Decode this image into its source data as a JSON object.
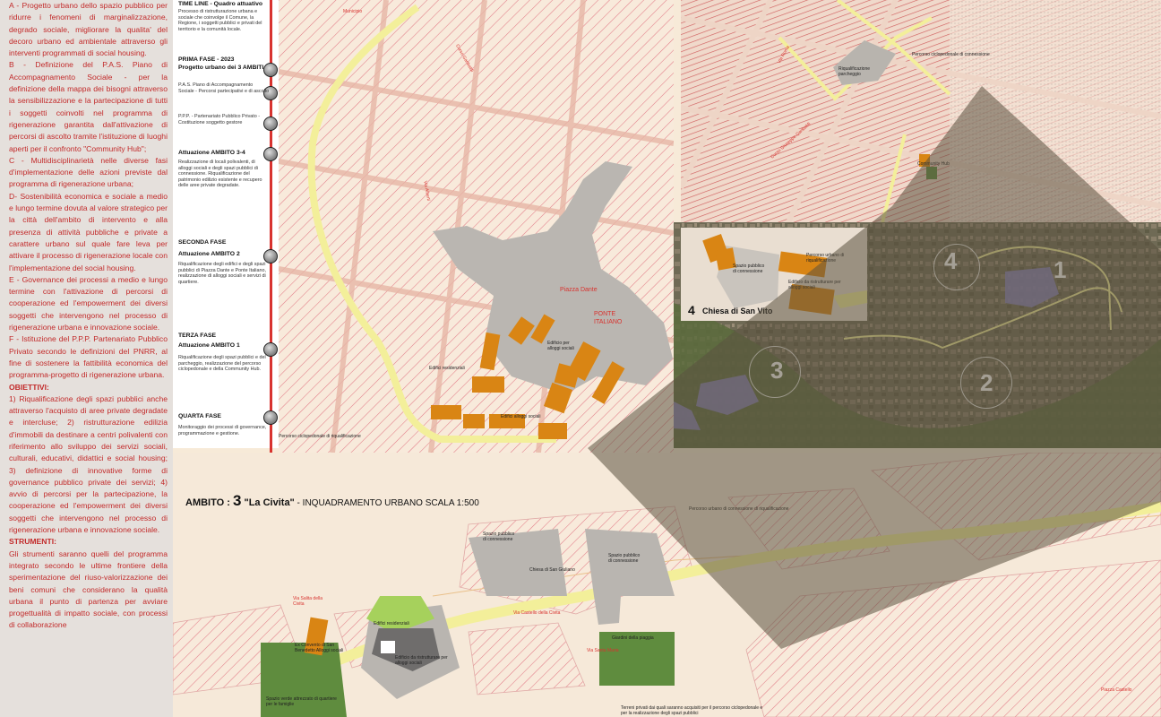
{
  "left_text": [
    {
      "text": "A - Progetto urbano dello spazio pubblico per ridurre i fenomeni di marginalizzazione, degrado sociale, migliorare la qualita' del decoro urbano ed ambientale attraverso gli interventi programmati di social housing.",
      "bold": false
    },
    {
      "text": "B - Definizione del P.A.S. Piano di Accompagnamento Sociale - per la definizione della mappa dei bisogni attraverso la sensibilizzazione e la partecipazione di tutti i soggetti coinvolti nel programma di rigenerazione garantita dall'attivazione di percorsi di ascolto tramite l'istituzione di luoghi aperti per il confronto \"Community Hub\";",
      "bold": false
    },
    {
      "text": "C - Multidisciplinarietà nelle diverse fasi d'implementazione delle azioni previste dal programma di rigenerazione urbana;",
      "bold": false
    },
    {
      "text": "D- Sostenibilità economica e sociale a medio e lungo termine dovuta al valore strategico per la città dell'ambito di intervento e alla presenza di attività pubbliche e private a carattere urbano sul quale fare leva per attivare il processo di rigenerazione locale con l'implementazione del social housing.",
      "bold": false
    },
    {
      "text": "E - Governance dei processi a medio e lungo termine con l'attivazione di percorsi di cooperazione ed l'empowerment dei diversi soggetti che intervengono nel processo di rigenerazione urbana e innovazione sociale.",
      "bold": false
    },
    {
      "text": "F - Istituzione del P.P.P. Partenariato Pubblico Privato secondo le definizioni del PNRR, al fine di sostenere la fattibilità economica del programma-progetto di rigenerazione urbana.",
      "bold": false
    },
    {
      "text": "OBIETTIVI:",
      "bold": true
    },
    {
      "text": "1) Riqualificazione degli spazi pubblici anche attraverso l'acquisto di aree private degradate e intercluse; 2) ristrutturazione edilizia d'immobili da destinare a centri polivalenti con riferimento allo sviluppo dei servizi sociali, culturali, educativi, didattici e social housing; 3) definizione di innovative forme di governance pubblico private dei servizi; 4) avvio di percorsi per la partecipazione, la cooperazione ed l'empowerment dei diversi soggetti che intervengono nel processo di rigenerazione urbana e innovazione sociale.",
      "bold": false
    },
    {
      "text": "STRUMENTI:",
      "bold": true
    },
    {
      "text": "Gli strumenti saranno quelli del programma integrato secondo le ultime frontiere della sperimentazione del riuso-valorizzazione dei beni comuni che considerano la qualità urbana il punto di partenza per avviare progettualità di impatto sociale, con processi di collaborazione",
      "bold": false
    }
  ],
  "timeline": {
    "time_line_label": "TIME LINE - Quadro attuativo",
    "intro": "Processo di ristrutturazione urbana e sociale che coinvolge il Comune, la Regione, i soggetti pubblici e privati del territorio e la comunità locale.",
    "phases": [
      {
        "title": "PRIMA FASE - 2023",
        "subtitle": "Progetto urbano dei 3 AMBITI",
        "body": ""
      },
      {
        "title": "",
        "subtitle": "",
        "body": "P.A.S. Piano di Accompagnamento Sociale - Percorsi partecipativi e di ascolto"
      },
      {
        "title": "",
        "subtitle": "",
        "body": "P.P.P. - Partenariato Pubblico Privato - Costituzione soggetto gestore"
      },
      {
        "title": "Attuazione AMBITO 3-4",
        "subtitle": "",
        "body": "Realizzazione di locali polivalenti, di alloggi sociali e degli spazi pubblici di connessione. Riqualificazione del patrimonio edilizio esistente e recupero delle aree private degradate."
      },
      {
        "title": "SECONDA FASE",
        "subtitle": "Attuazione AMBITO 2",
        "body": "Riqualificazione degli edifici e degli spazi pubblici di Piazza Dante e Ponte Italiano, realizzazione di alloggi sociali e servizi di quartiere."
      },
      {
        "title": "TERZA FASE",
        "subtitle": "Attuazione AMBITO 1",
        "body": "Riqualificazione degli spazi pubblici e del parcheggio, realizzazione del percorso ciclopedonale e della Community Hub."
      },
      {
        "title": "QUARTA FASE",
        "subtitle": "",
        "body": "Monitoraggio dei processi di governance, programmazione e gestione."
      }
    ]
  },
  "map_labels": {
    "piazza_dante": "Piazza Dante",
    "ponte_italiano": "PONTE ITALIANO",
    "municipio": "Municipio",
    "corso_garibaldi": "Corso Garibaldi",
    "via_roma": "Via Roma",
    "via_alberti": "Via Alberti",
    "edifici_residenziali": "Edifici residenziali",
    "edificio_da_ristrutturare": "Edificio per alloggi sociali",
    "edifici_alloggi_sociali": "Edifici alloggi sociali",
    "percorso_ciclopedonale_1": "Percorso ciclopedonale di riqualificazione",
    "riqualificazione_parcheggio": "Riqualificazione parcheggio",
    "percorso_connessione": "Percorso ciclopedonale di connessione",
    "corso_garibaldi_2": "Corso Giuseppe Garibaldi",
    "community_hub": "Community Hub",
    "spazio_pubblico_connessione": "Spazio pubblico di connessione",
    "edificio_da_ristrutturare_2": "Edificio da ristrutturare per alloggi sociali",
    "percorso_urbano": "Percorso urbano di riqualificazione",
    "chiesa_num": "4",
    "chiesa_label": "Chiesa di San Vito",
    "num_1": "1",
    "num_2": "2",
    "num_3": "3",
    "num_4": "4"
  },
  "ambito_title": {
    "prefix": "AMBITO : ",
    "number": "3",
    "name": " \"La Civita\"",
    "suffix": " - INQUADRAMENTO URBANO SCALA 1:500"
  },
  "bottom_labels": {
    "percorso_urbano": "Percorso urbano di connessione di riqualificazione",
    "spazio_pubblico_1": "Spazio pubblico di connessione",
    "chiesa_san_giuliano": "Chiesa di San Giuliano",
    "spazio_pubblico_2": "Spazio pubblico di connessione",
    "giardini_piaggia": "Giardini della piaggia",
    "via_1": "Via Salita della Civita",
    "via_2": "Via Castello della Civita",
    "via_3": "Via Santa Maria",
    "piazza_castello": "Piazza Castello",
    "ex_convento": "Ex Convento di San Benedetto Alloggi sociali",
    "edifici_residenziali": "Edifici residenziali",
    "edificio_da_ristrutturare": "Edificio da ristrutturare per alloggi sociali",
    "spazio_verde": "Spazio verde attrezzato di quartiere per le famiglie",
    "note": "Terreni privati dai quali saranno acquisiti per il percorso ciclopedonale e per la realizzazione degli spazi pubblici"
  },
  "colors": {
    "left_text": "#c22a2a",
    "timeline_line": "#d8332f",
    "building_orange": "#d98514",
    "public_grey": "#b9b5b0",
    "path_yellow": "#f3ef9a",
    "green": "#5f8c3e",
    "hatch": "#d84c64"
  }
}
